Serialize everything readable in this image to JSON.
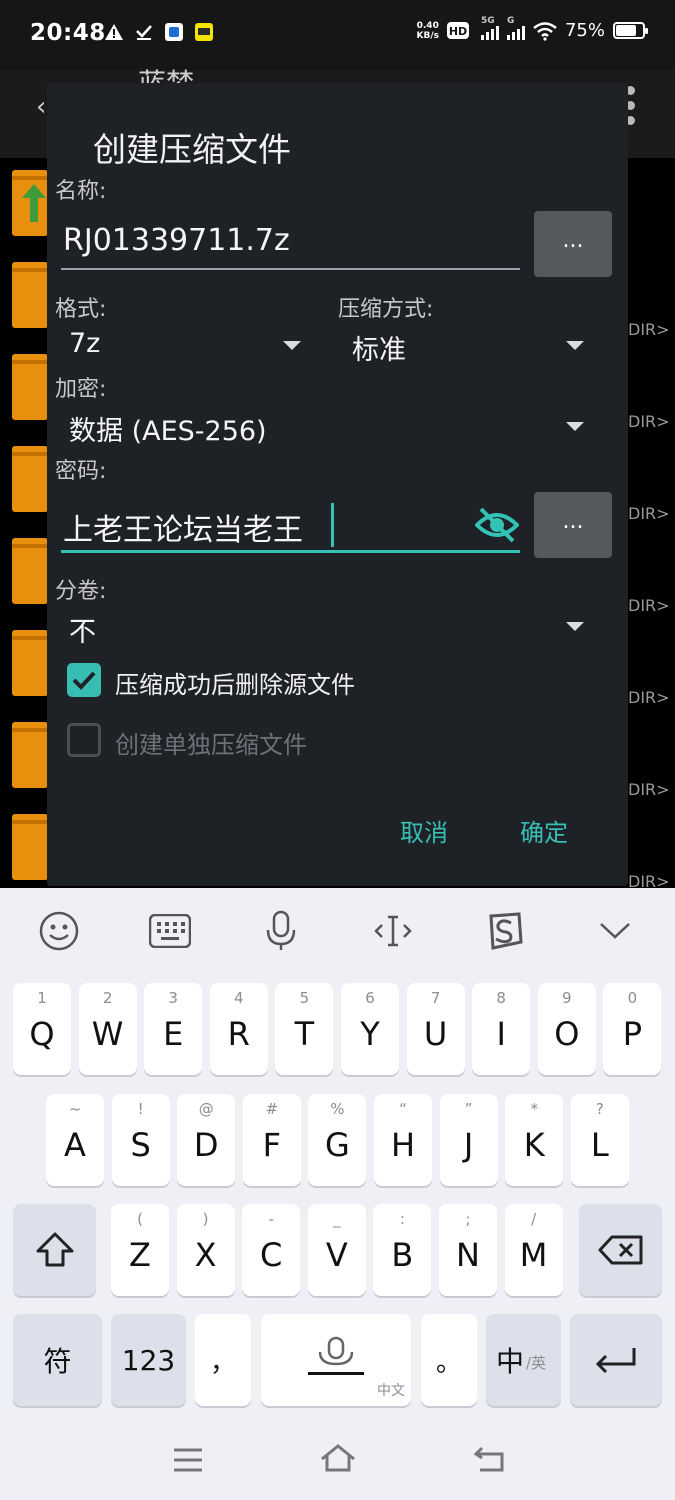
{
  "status_bar": {
    "time": "20:48",
    "net_speed_value": "0.40",
    "net_speed_unit": "KB/s",
    "hd_label": "HD",
    "signal1_label": "5G",
    "signal2_label": "G",
    "battery_percent": "75%",
    "battery_level": 0.75
  },
  "background_app": {
    "title": "蓝梦",
    "dir_label": "DIR>"
  },
  "dialog": {
    "title": "创建压缩文件",
    "name_label": "名称:",
    "name_value": "RJ01339711.7z",
    "name_browse": "...",
    "format_label": "格式:",
    "format_value": "7z",
    "compression_label": "压缩方式:",
    "compression_value": "标准",
    "encryption_label": "加密:",
    "encryption_value": "数据 (AES-256)",
    "password_label": "密码:",
    "password_value": "上老王论坛当老王",
    "password_browse": "...",
    "split_label": "分卷:",
    "split_value": "不",
    "delete_source_label": "压缩成功后删除源文件",
    "delete_source_checked": true,
    "separate_archive_label": "创建单独压缩文件",
    "separate_archive_checked": false,
    "cancel_label": "取消",
    "ok_label": "确定"
  },
  "keyboard": {
    "row1": [
      {
        "hint": "1",
        "key": "Q"
      },
      {
        "hint": "2",
        "key": "W"
      },
      {
        "hint": "3",
        "key": "E"
      },
      {
        "hint": "4",
        "key": "R"
      },
      {
        "hint": "5",
        "key": "T"
      },
      {
        "hint": "6",
        "key": "Y"
      },
      {
        "hint": "7",
        "key": "U"
      },
      {
        "hint": "8",
        "key": "I"
      },
      {
        "hint": "9",
        "key": "O"
      },
      {
        "hint": "0",
        "key": "P"
      }
    ],
    "row2": [
      {
        "hint": "~",
        "key": "A"
      },
      {
        "hint": "!",
        "key": "S"
      },
      {
        "hint": "@",
        "key": "D"
      },
      {
        "hint": "#",
        "key": "F"
      },
      {
        "hint": "%",
        "key": "G"
      },
      {
        "hint": "“",
        "key": "H"
      },
      {
        "hint": "”",
        "key": "J"
      },
      {
        "hint": "*",
        "key": "K"
      },
      {
        "hint": "?",
        "key": "L"
      }
    ],
    "row3": [
      {
        "hint": "(",
        "key": "Z"
      },
      {
        "hint": ")",
        "key": "X"
      },
      {
        "hint": "-",
        "key": "C"
      },
      {
        "hint": "_",
        "key": "V"
      },
      {
        "hint": ":",
        "key": "B"
      },
      {
        "hint": ";",
        "key": "N"
      },
      {
        "hint": "/",
        "key": "M"
      }
    ],
    "symbols_label": "符",
    "numbers_label": "123",
    "comma_label": "，",
    "space_label": "中文",
    "period_label": "。",
    "lang_primary": "中",
    "lang_secondary": "/英"
  }
}
